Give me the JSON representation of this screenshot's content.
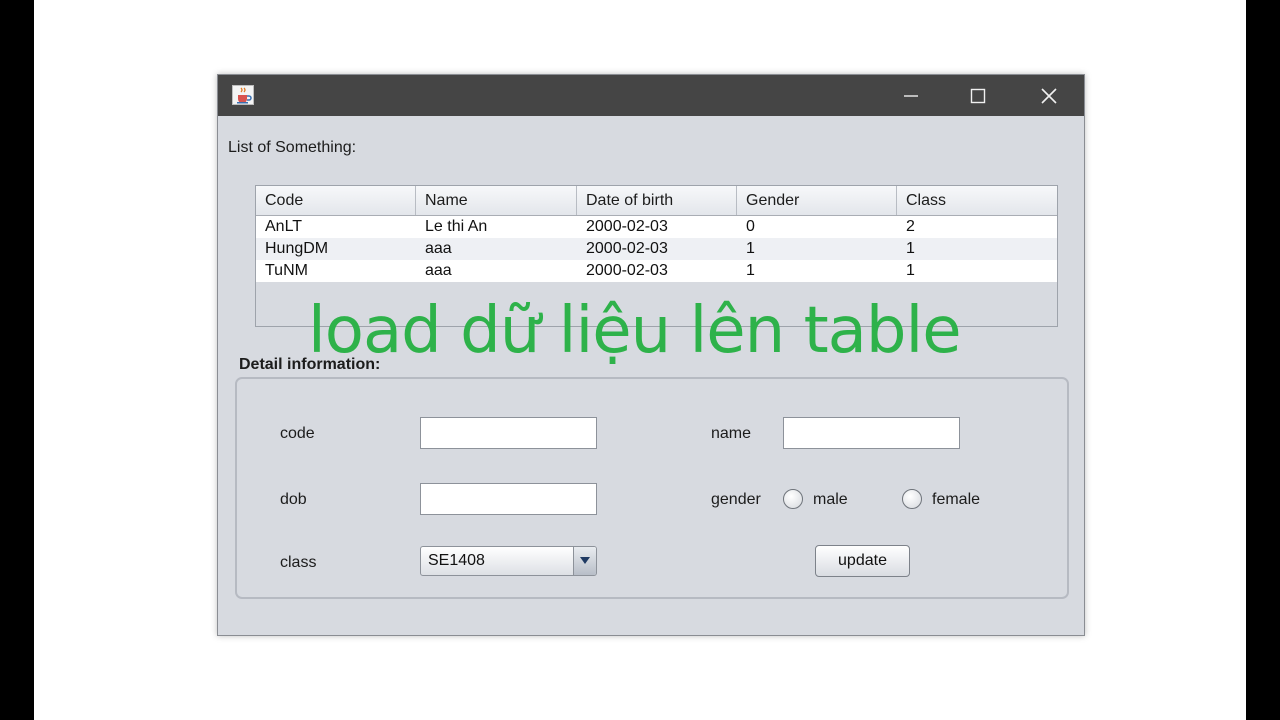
{
  "window": {
    "icon": "java-cup-icon",
    "controls": {
      "minimize": "minimize-icon",
      "maximize": "maximize-icon",
      "close": "close-icon"
    }
  },
  "list_title": "List of Something:",
  "table": {
    "headers": [
      "Code",
      "Name",
      "Date of birth",
      "Gender",
      "Class"
    ],
    "rows": [
      [
        "AnLT",
        "Le thi An",
        "2000-02-03",
        "0",
        "2"
      ],
      [
        "HungDM",
        "aaa",
        "2000-02-03",
        "1",
        "1"
      ],
      [
        "TuNM",
        "aaa",
        "2000-02-03",
        "1",
        "1"
      ]
    ]
  },
  "overlay_caption": "load dữ liệu lên table",
  "detail": {
    "title": "Detail information:",
    "code_label": "code",
    "code_value": "",
    "name_label": "name",
    "name_value": "",
    "dob_label": "dob",
    "dob_value": "",
    "gender_label": "gender",
    "male_label": "male",
    "female_label": "female",
    "class_label": "class",
    "class_selected": "SE1408",
    "update_label": "update"
  },
  "colors": {
    "titlebar": "#454545",
    "window_bg": "#d7dae0",
    "caption": "#2eb24a"
  }
}
